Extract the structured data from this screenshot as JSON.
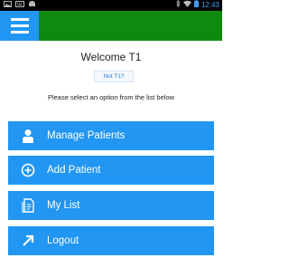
{
  "status_bar": {
    "time": "12:43",
    "left_icons": [
      "photo-icon",
      "keyboard-icon",
      "android-icon"
    ],
    "right_icons": [
      "bluetooth-icon",
      "wifi-icon",
      "battery-icon"
    ]
  },
  "app_bar": {
    "color": "#0e8a0e",
    "menu_icon": "hamburger-menu-icon"
  },
  "welcome": {
    "title": "Welcome T1",
    "badge": "Not T1?",
    "prompt": "Please select an option from the list below"
  },
  "menu": {
    "items": [
      {
        "label": "Manage Patients",
        "icon": "person-icon"
      },
      {
        "label": "Add Patient",
        "icon": "add-circle-icon"
      },
      {
        "label": "My List",
        "icon": "list-document-icon"
      },
      {
        "label": "Logout",
        "icon": "arrow-up-right-icon"
      }
    ]
  },
  "colors": {
    "accent": "#2196f3",
    "appbar": "#0e8a0e",
    "time": "#3d9be9"
  }
}
